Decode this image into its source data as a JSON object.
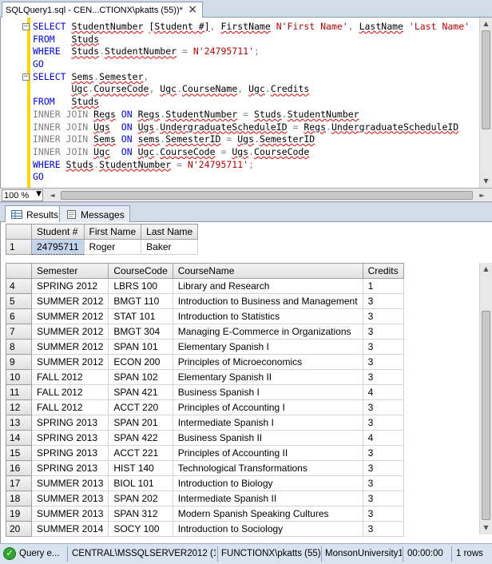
{
  "doc_tab": {
    "title": "SQLQuery1.sql - CEN...CTIONX\\pkatts (55))*",
    "close": "×"
  },
  "editor": {
    "lines": [
      [
        {
          "t": "SELECT ",
          "c": "kw"
        },
        {
          "t": "StudentNumber",
          "c": "sq"
        },
        {
          "t": " ",
          "c": ""
        },
        {
          "t": "[Student #]",
          "c": "sq"
        },
        {
          "t": ", ",
          "c": "gray"
        },
        {
          "t": "FirstName",
          "c": "sq"
        },
        {
          "t": " ",
          "c": ""
        },
        {
          "t": "N'First Name'",
          "c": "str"
        },
        {
          "t": ", ",
          "c": "gray"
        },
        {
          "t": "LastName",
          "c": "sq"
        },
        {
          "t": " ",
          "c": ""
        },
        {
          "t": "'Last Name'",
          "c": "str"
        }
      ],
      [
        {
          "t": "FROM   ",
          "c": "kw"
        },
        {
          "t": "Studs",
          "c": "sq"
        }
      ],
      [
        {
          "t": "WHERE  ",
          "c": "kw"
        },
        {
          "t": "Studs",
          "c": "sq"
        },
        {
          "t": ".",
          "c": "gray"
        },
        {
          "t": "StudentNumber",
          "c": "sq"
        },
        {
          "t": " = ",
          "c": "gray"
        },
        {
          "t": "N'24795711'",
          "c": "str"
        },
        {
          "t": ";",
          "c": "gray"
        }
      ],
      [
        {
          "t": "GO",
          "c": "kw"
        }
      ],
      [
        {
          "t": "SELECT ",
          "c": "kw"
        },
        {
          "t": "Sems",
          "c": "sq"
        },
        {
          "t": ".",
          "c": "gray"
        },
        {
          "t": "Semester",
          "c": "sq"
        },
        {
          "t": ",",
          "c": "gray"
        }
      ],
      [
        {
          "t": "       ",
          "c": ""
        },
        {
          "t": "Ugc",
          "c": "sq"
        },
        {
          "t": ".",
          "c": "gray"
        },
        {
          "t": "CourseCode",
          "c": "sq"
        },
        {
          "t": ", ",
          "c": "gray"
        },
        {
          "t": "Ugc",
          "c": "sq"
        },
        {
          "t": ".",
          "c": "gray"
        },
        {
          "t": "CourseName",
          "c": "sq"
        },
        {
          "t": ", ",
          "c": "gray"
        },
        {
          "t": "Ugc",
          "c": "sq"
        },
        {
          "t": ".",
          "c": "gray"
        },
        {
          "t": "Credits",
          "c": "sq"
        }
      ],
      [
        {
          "t": "FROM   ",
          "c": "kw"
        },
        {
          "t": "Studs",
          "c": "sq"
        }
      ],
      [
        {
          "t": "INNER JOIN ",
          "c": "gray"
        },
        {
          "t": "Regs",
          "c": "sq"
        },
        {
          "t": " ON ",
          "c": "kw"
        },
        {
          "t": "Regs",
          "c": "sq"
        },
        {
          "t": ".",
          "c": "gray"
        },
        {
          "t": "StudentNumber",
          "c": "sq"
        },
        {
          "t": " = ",
          "c": "gray"
        },
        {
          "t": "Studs",
          "c": "sq"
        },
        {
          "t": ".",
          "c": "gray"
        },
        {
          "t": "StudentNumber",
          "c": "sq"
        }
      ],
      [
        {
          "t": "INNER JOIN ",
          "c": "gray"
        },
        {
          "t": "Ugs",
          "c": "sq"
        },
        {
          "t": "  ON ",
          "c": "kw"
        },
        {
          "t": "Ugs",
          "c": "sq"
        },
        {
          "t": ".",
          "c": "gray"
        },
        {
          "t": "UndergraduateScheduleID",
          "c": "sq"
        },
        {
          "t": " = ",
          "c": "gray"
        },
        {
          "t": "Regs",
          "c": "sq"
        },
        {
          "t": ".",
          "c": "gray"
        },
        {
          "t": "UndergraduateScheduleID",
          "c": "sq"
        }
      ],
      [
        {
          "t": "INNER JOIN ",
          "c": "gray"
        },
        {
          "t": "Sems",
          "c": "sq"
        },
        {
          "t": " ON ",
          "c": "kw"
        },
        {
          "t": "sems",
          "c": "sq"
        },
        {
          "t": ".",
          "c": "gray"
        },
        {
          "t": "SemesterID",
          "c": "sq"
        },
        {
          "t": " = ",
          "c": "gray"
        },
        {
          "t": "Ugs",
          "c": "sq"
        },
        {
          "t": ".",
          "c": "gray"
        },
        {
          "t": "SemesterID",
          "c": "sq"
        }
      ],
      [
        {
          "t": "INNER JOIN ",
          "c": "gray"
        },
        {
          "t": "Ugc",
          "c": "sq"
        },
        {
          "t": "  ON ",
          "c": "kw"
        },
        {
          "t": "Ugc",
          "c": "sq"
        },
        {
          "t": ".",
          "c": "gray"
        },
        {
          "t": "CourseCode",
          "c": "sq"
        },
        {
          "t": " = ",
          "c": "gray"
        },
        {
          "t": "Ugs",
          "c": "sq"
        },
        {
          "t": ".",
          "c": "gray"
        },
        {
          "t": "CourseCode",
          "c": "sq"
        }
      ],
      [
        {
          "t": "WHERE ",
          "c": "kw"
        },
        {
          "t": "Studs",
          "c": "sq"
        },
        {
          "t": ".",
          "c": "gray"
        },
        {
          "t": "StudentNumber",
          "c": "sq"
        },
        {
          "t": " = ",
          "c": "gray"
        },
        {
          "t": "N'24795711'",
          "c": "str"
        },
        {
          "t": ";",
          "c": "gray"
        }
      ],
      [
        {
          "t": "GO",
          "c": "kw"
        }
      ]
    ],
    "collapse_symbol": "−"
  },
  "zoom": {
    "value": "100 %"
  },
  "result_tabs": [
    {
      "label": "Results"
    },
    {
      "label": "Messages"
    }
  ],
  "grid1": {
    "headers": [
      "Student #",
      "First Name",
      "Last Name"
    ],
    "rows": [
      {
        "n": "1",
        "cells": [
          "24795711",
          "Roger",
          "Baker"
        ]
      }
    ]
  },
  "grid2": {
    "headers": [
      "Semester",
      "CourseCode",
      "CourseName",
      "Credits"
    ],
    "rows": [
      {
        "n": "4",
        "cells": [
          "SPRING 2012",
          "LBRS 100",
          "Library and Research",
          "1"
        ]
      },
      {
        "n": "5",
        "cells": [
          "SUMMER 2012",
          "BMGT 110",
          "Introduction to Business and Management",
          "3"
        ]
      },
      {
        "n": "6",
        "cells": [
          "SUMMER 2012",
          "STAT 101",
          "Introduction to Statistics",
          "3"
        ]
      },
      {
        "n": "7",
        "cells": [
          "SUMMER 2012",
          "BMGT 304",
          "Managing E-Commerce in Organizations",
          "3"
        ]
      },
      {
        "n": "8",
        "cells": [
          "SUMMER 2012",
          "SPAN 101",
          "Elementary Spanish I",
          "3"
        ]
      },
      {
        "n": "9",
        "cells": [
          "SUMMER 2012",
          "ECON 200",
          "Principles of Microeconomics",
          "3"
        ]
      },
      {
        "n": "10",
        "cells": [
          "FALL 2012",
          "SPAN 102",
          "Elementary Spanish II",
          "3"
        ]
      },
      {
        "n": "11",
        "cells": [
          "FALL 2012",
          "SPAN 421",
          "Business Spanish I",
          "4"
        ]
      },
      {
        "n": "12",
        "cells": [
          "FALL 2012",
          "ACCT 220",
          "Principles of Accounting I",
          "3"
        ]
      },
      {
        "n": "13",
        "cells": [
          "SPRING 2013",
          "SPAN 201",
          "Intermediate Spanish I",
          "3"
        ]
      },
      {
        "n": "14",
        "cells": [
          "SPRING 2013",
          "SPAN 422",
          "Business Spanish II",
          "4"
        ]
      },
      {
        "n": "15",
        "cells": [
          "SPRING 2013",
          "ACCT 221",
          "Principles of Accounting II",
          "3"
        ]
      },
      {
        "n": "16",
        "cells": [
          "SPRING 2013",
          "HIST 140",
          "Technological Transformations",
          "3"
        ]
      },
      {
        "n": "17",
        "cells": [
          "SUMMER 2013",
          "BIOL 101",
          "Introduction to Biology",
          "3"
        ]
      },
      {
        "n": "18",
        "cells": [
          "SUMMER 2013",
          "SPAN 202",
          "Intermediate Spanish II",
          "3"
        ]
      },
      {
        "n": "19",
        "cells": [
          "SUMMER 2013",
          "SPAN 312",
          "Modern Spanish Speaking Cultures",
          "3"
        ]
      },
      {
        "n": "20",
        "cells": [
          "SUMMER 2014",
          "SOCY 100",
          "Introduction to Sociology",
          "3"
        ]
      }
    ]
  },
  "status": {
    "query": "Query e...",
    "server": "CENTRAL\\MSSQLSERVER2012 (11....",
    "user": "FUNCTIONX\\pkatts (55)",
    "database": "MonsonUniversity1",
    "time": "00:00:00",
    "rows": "1 rows",
    "ok_icon": "check-icon",
    "ok_glyph": "✓"
  },
  "scroll": {
    "up": "▲",
    "down": "▼",
    "left": "◄",
    "right": "►"
  },
  "colors": {
    "keyword": "#0000ff",
    "string": "#c00000",
    "comment_gray": "#808080",
    "selection": "#c2d4ec",
    "status_ok": "#2ea82e"
  }
}
